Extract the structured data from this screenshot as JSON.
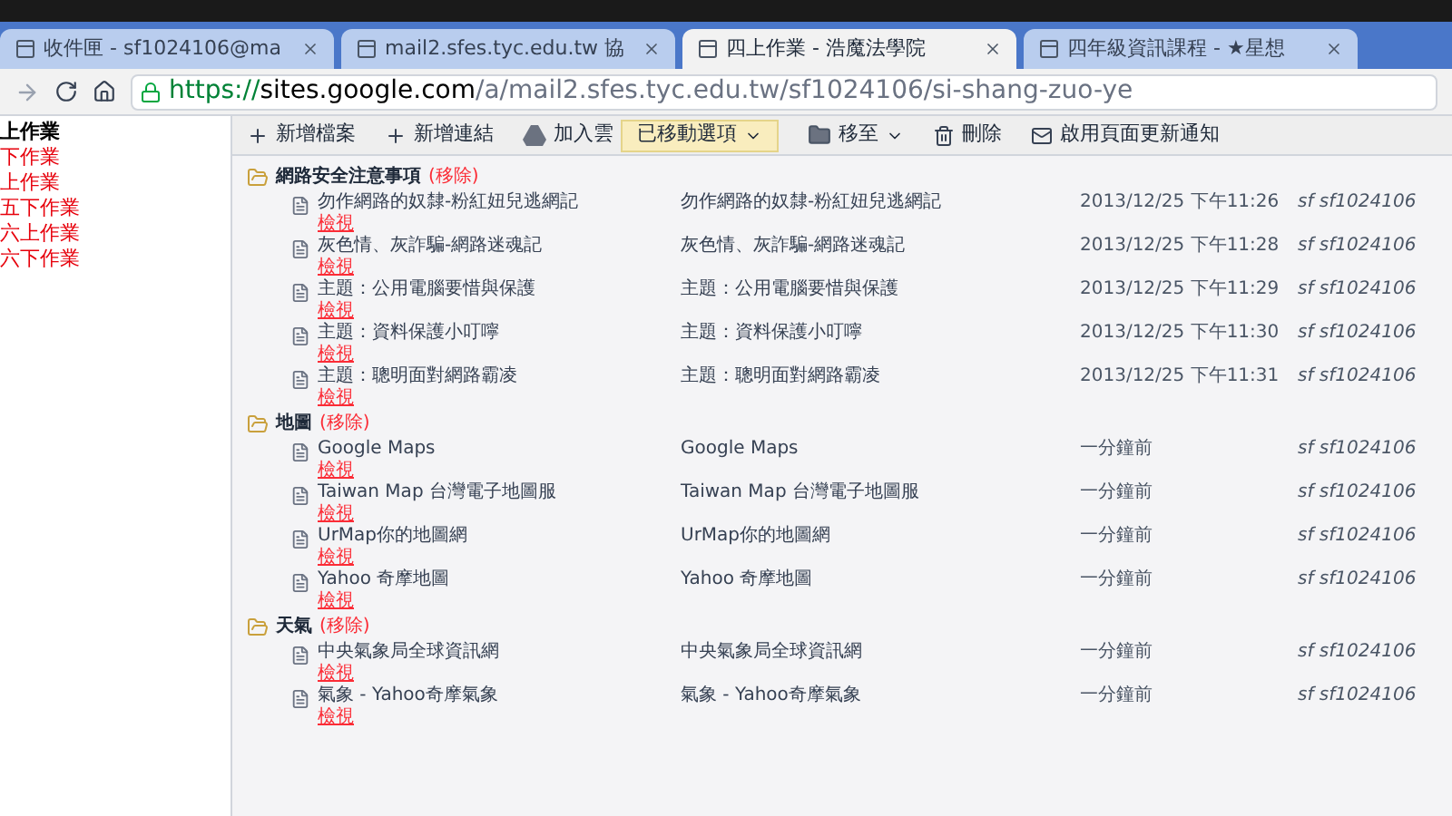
{
  "tabs": [
    {
      "label": "收件匣 - sf1024106@ma",
      "selected": false
    },
    {
      "label": "mail2.sfes.tyc.edu.tw 協",
      "selected": false
    },
    {
      "label": "四上作業 - 浩魔法學院",
      "selected": true
    },
    {
      "label": "四年級資訊課程 - ★星想",
      "selected": false
    }
  ],
  "address_bar": {
    "scheme": "https://",
    "host": "sites.google.com",
    "path": "/a/mail2.sfes.tyc.edu.tw/sf1024106/si-shang-zuo-ye"
  },
  "sidebar": {
    "items": [
      {
        "label": "上作業",
        "selected": true
      },
      {
        "label": "下作業",
        "selected": false
      },
      {
        "label": "上作業",
        "selected": false
      },
      {
        "label": "五下作業",
        "selected": false
      },
      {
        "label": "六上作業",
        "selected": false
      },
      {
        "label": "六下作業",
        "selected": false
      }
    ]
  },
  "toolbar": [
    {
      "kind": "add",
      "label": "新增檔案"
    },
    {
      "kind": "add",
      "label": "新增連結"
    },
    {
      "kind": "drive",
      "label": "加入雲"
    },
    {
      "kind": "move",
      "label": "移至"
    },
    {
      "kind": "delete",
      "label": "刪除"
    },
    {
      "kind": "mail",
      "label": "啟用頁面更新通知"
    }
  ],
  "notice": {
    "label": "已移動選項"
  },
  "sections": [
    {
      "title": "網路安全注意事項",
      "remove": "(移除)",
      "rows": [
        {
          "name": "勿作網路的奴隸-粉紅妞兒逃網記",
          "view": "檢視",
          "description": "勿作網路的奴隸-粉紅妞兒逃網記",
          "time": "2013/12/25 下午11:26",
          "user": "sf sf1024106"
        },
        {
          "name": "灰色情、灰詐騙-網路迷魂記",
          "view": "檢視",
          "description": "灰色情、灰詐騙-網路迷魂記",
          "time": "2013/12/25 下午11:28",
          "user": "sf sf1024106"
        },
        {
          "name": "主題：公用電腦要惜與保護",
          "view": "檢視",
          "description": "主題：公用電腦要惜與保護",
          "time": "2013/12/25 下午11:29",
          "user": "sf sf1024106"
        },
        {
          "name": "主題：資料保護小叮嚀",
          "view": "檢視",
          "description": "主題：資料保護小叮嚀",
          "time": "2013/12/25 下午11:30",
          "user": "sf sf1024106"
        },
        {
          "name": "主題：聰明面對網路霸凌",
          "view": "檢視",
          "description": "主題：聰明面對網路霸凌",
          "time": "2013/12/25 下午11:31",
          "user": "sf sf1024106"
        }
      ]
    },
    {
      "title": "地圖",
      "remove": "(移除)",
      "rows": [
        {
          "name": "Google Maps",
          "view": "檢視",
          "description": "Google Maps",
          "time": "一分鐘前",
          "user": "sf sf1024106"
        },
        {
          "name": "Taiwan Map 台灣電子地圖服",
          "view": "檢視",
          "description": "Taiwan Map 台灣電子地圖服",
          "time": "一分鐘前",
          "user": "sf sf1024106"
        },
        {
          "name": "UrMap你的地圖網",
          "view": "檢視",
          "description": "UrMap你的地圖網",
          "time": "一分鐘前",
          "user": "sf sf1024106"
        },
        {
          "name": "Yahoo 奇摩地圖",
          "view": "檢視",
          "description": "Yahoo 奇摩地圖",
          "time": "一分鐘前",
          "user": "sf sf1024106"
        }
      ]
    },
    {
      "title": "天氣",
      "remove": "(移除)",
      "rows": [
        {
          "name": "中央氣象局全球資訊網",
          "view": "檢視",
          "description": "中央氣象局全球資訊網",
          "time": "一分鐘前",
          "user": "sf sf1024106"
        },
        {
          "name": "氣象 - Yahoo奇摩氣象",
          "view": "檢視",
          "description": "氣象 - Yahoo奇摩氣象",
          "time": "一分鐘前",
          "user": "sf sf1024106"
        }
      ]
    }
  ]
}
